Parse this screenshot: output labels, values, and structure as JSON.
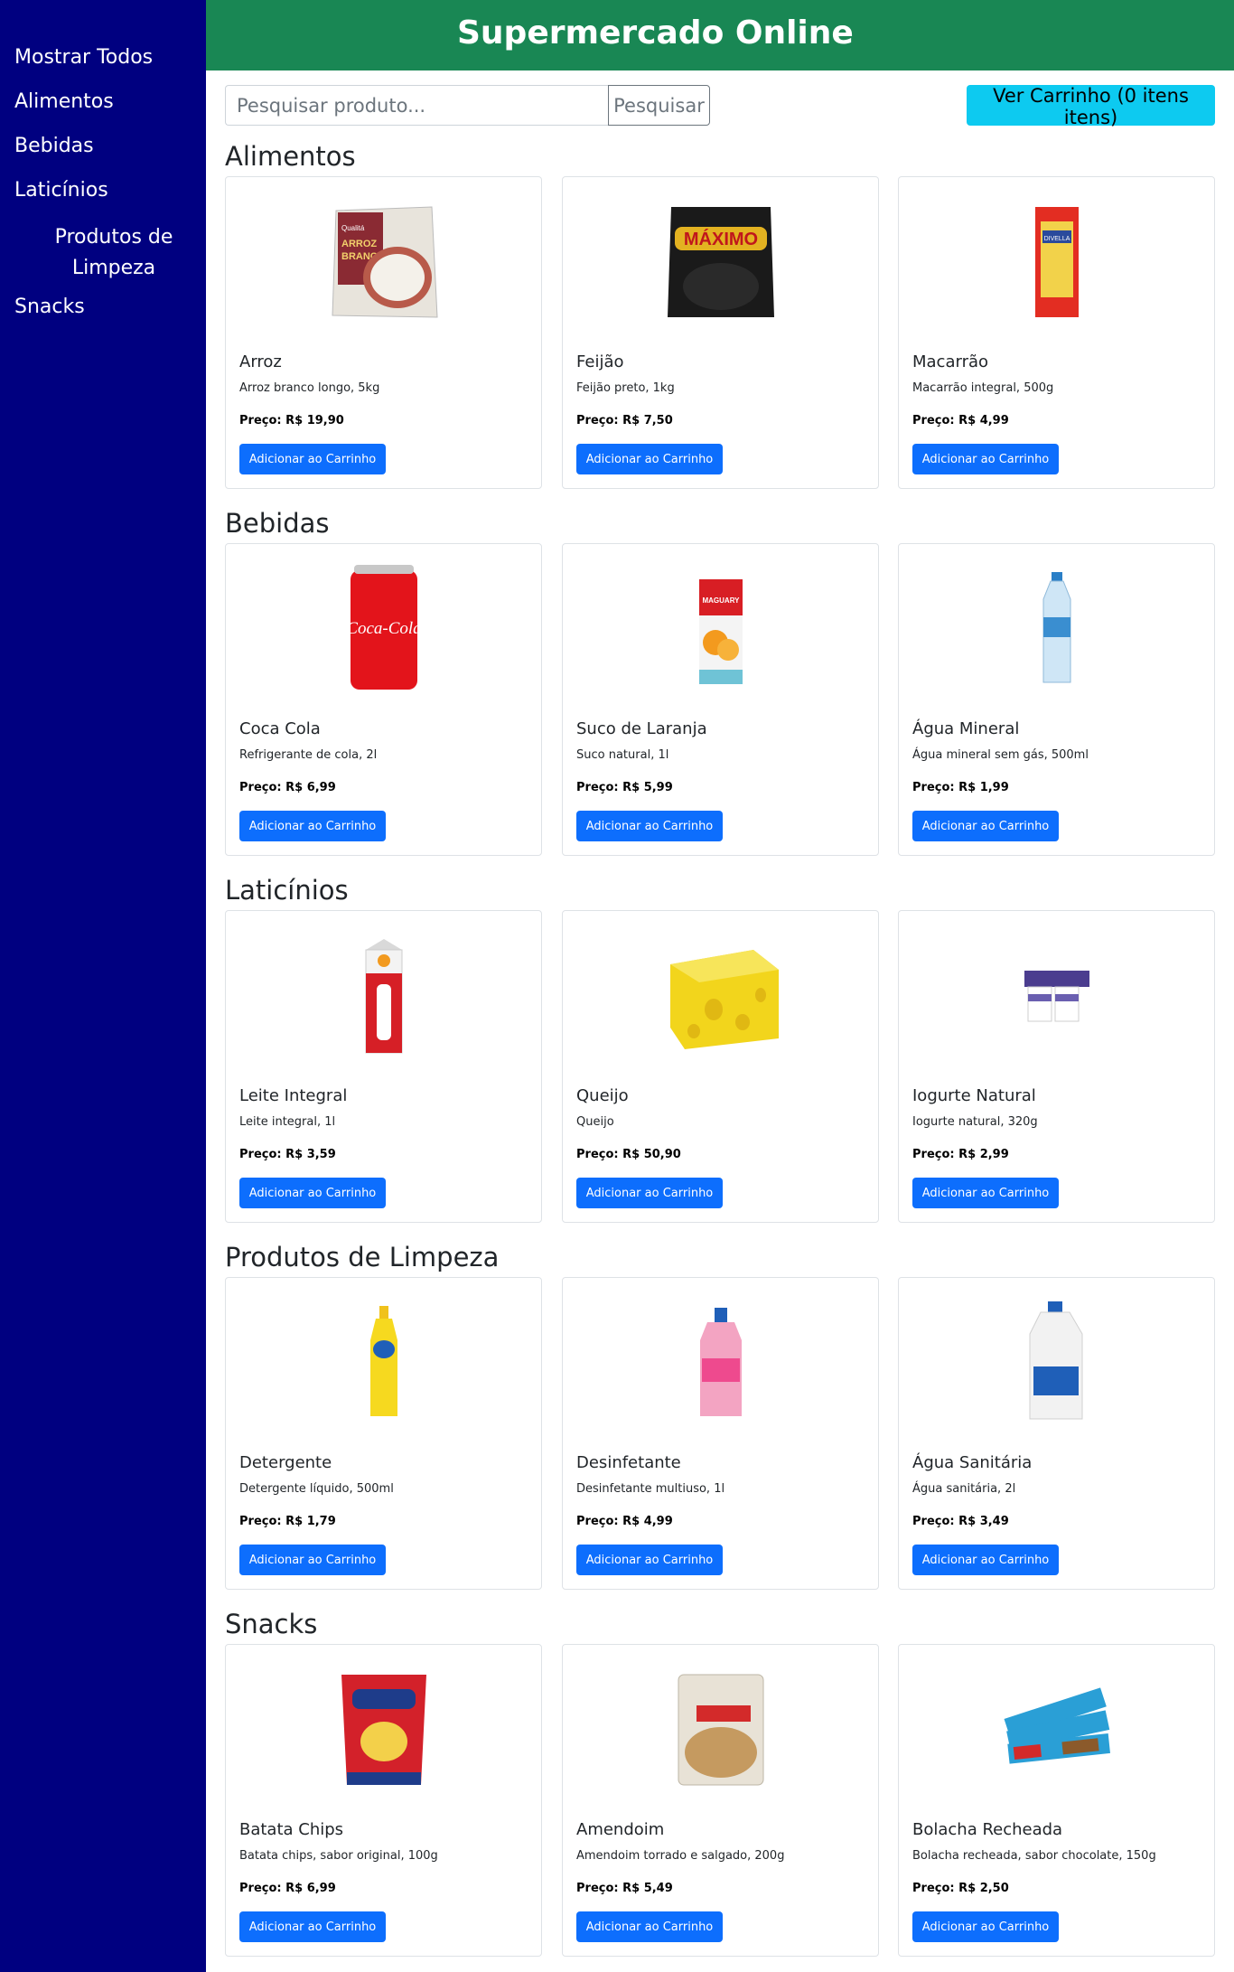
{
  "sidebar": {
    "items": [
      {
        "label": "Mostrar Todos"
      },
      {
        "label": "Alimentos"
      },
      {
        "label": "Bebidas"
      },
      {
        "label": "Laticínios"
      },
      {
        "label": "Produtos de Limpeza"
      },
      {
        "label": "Snacks"
      }
    ]
  },
  "header": {
    "title": "Supermercado Online"
  },
  "search": {
    "placeholder": "Pesquisar produto...",
    "button_label": "Pesquisar"
  },
  "cart": {
    "label": "Ver Carrinho (0 itens itens)"
  },
  "add_label": "Adicionar ao Carrinho",
  "sections": [
    {
      "title": "Alimentos",
      "products": [
        {
          "name": "Arroz",
          "desc": "Arroz branco longo, 5kg",
          "price": "Preço: R$ 19,90",
          "icon": "rice-bag-icon"
        },
        {
          "name": "Feijão",
          "desc": "Feijão preto, 1kg",
          "price": "Preço: R$ 7,50",
          "icon": "beans-bag-icon"
        },
        {
          "name": "Macarrão",
          "desc": "Macarrão integral, 500g",
          "price": "Preço: R$ 4,99",
          "icon": "pasta-pack-icon"
        }
      ]
    },
    {
      "title": "Bebidas",
      "products": [
        {
          "name": "Coca Cola",
          "desc": "Refrigerante de cola, 2l",
          "price": "Preço: R$ 6,99",
          "icon": "soda-can-icon"
        },
        {
          "name": "Suco de Laranja",
          "desc": "Suco natural, 1l",
          "price": "Preço: R$ 5,99",
          "icon": "juice-box-icon"
        },
        {
          "name": "Água Mineral",
          "desc": "Água mineral sem gás, 500ml",
          "price": "Preço: R$ 1,99",
          "icon": "water-bottle-icon"
        }
      ]
    },
    {
      "title": "Laticínios",
      "products": [
        {
          "name": "Leite Integral",
          "desc": "Leite integral, 1l",
          "price": "Preço: R$ 3,59",
          "icon": "milk-carton-icon"
        },
        {
          "name": "Queijo",
          "desc": "Queijo",
          "price": "Preço: R$ 50,90",
          "icon": "cheese-icon"
        },
        {
          "name": "Iogurte Natural",
          "desc": "Iogurte natural, 320g",
          "price": "Preço: R$ 2,99",
          "icon": "yogurt-icon"
        }
      ]
    },
    {
      "title": "Produtos de Limpeza",
      "products": [
        {
          "name": "Detergente",
          "desc": "Detergente líquido, 500ml",
          "price": "Preço: R$ 1,79",
          "icon": "detergent-bottle-icon"
        },
        {
          "name": "Desinfetante",
          "desc": "Desinfetante multiuso, 1l",
          "price": "Preço: R$ 4,99",
          "icon": "disinfectant-bottle-icon"
        },
        {
          "name": "Água Sanitária",
          "desc": "Água sanitária, 2l",
          "price": "Preço: R$ 3,49",
          "icon": "bleach-jug-icon"
        }
      ]
    },
    {
      "title": "Snacks",
      "products": [
        {
          "name": "Batata Chips",
          "desc": "Batata chips, sabor original, 100g",
          "price": "Preço: R$ 6,99",
          "icon": "chips-bag-icon"
        },
        {
          "name": "Amendoim",
          "desc": "Amendoim torrado e salgado, 200g",
          "price": "Preço: R$ 5,49",
          "icon": "peanut-bag-icon"
        },
        {
          "name": "Bolacha Recheada",
          "desc": "Bolacha recheada, sabor chocolate, 150g",
          "price": "Preço: R$ 2,50",
          "icon": "cookie-pack-icon"
        }
      ]
    }
  ],
  "colors": {
    "sidebar": "#000080",
    "header": "#198754",
    "cart_button": "#0dcaf0",
    "add_button": "#0d6efd"
  }
}
